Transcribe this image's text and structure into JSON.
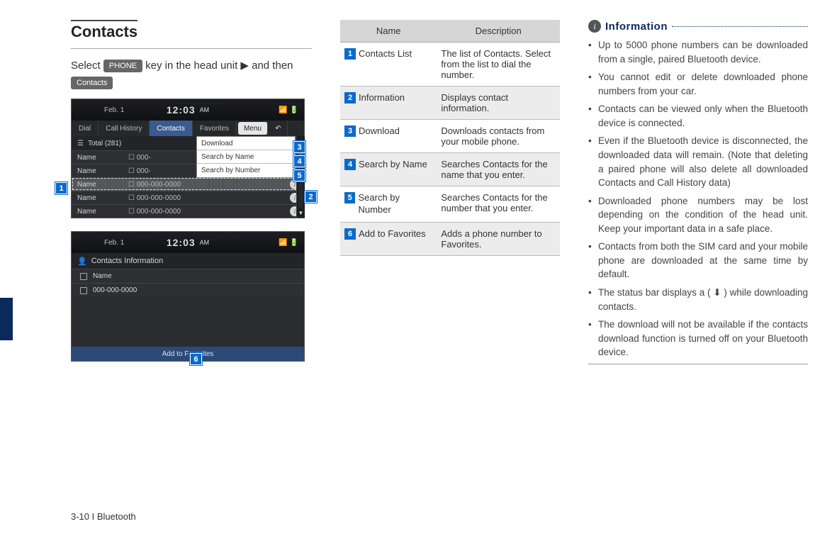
{
  "section_title": "Contacts",
  "intro": {
    "prefix": "Select ",
    "phone_key": "PHONE",
    "mid": " key in the head unit ▶ and then ",
    "contacts_key": "Contacts"
  },
  "screenshot1": {
    "date": "Feb. 1",
    "time": "12:03",
    "ampm": "AM",
    "tabs": {
      "dial": "Dial",
      "history": "Call History",
      "contacts": "Contacts",
      "favorites": "Favorites",
      "menu": "Menu",
      "back": "↶"
    },
    "total_label": "Total (281)",
    "dropdown": {
      "download": "Download",
      "by_name": "Search by Name",
      "by_number": "Search by Number"
    },
    "rows": [
      {
        "name": "Name",
        "phone": "000-"
      },
      {
        "name": "Name",
        "phone": "000-"
      },
      {
        "name": "Name",
        "phone": "000-000-0000",
        "selected": true
      },
      {
        "name": "Name",
        "phone": "000-000-0000"
      },
      {
        "name": "Name",
        "phone": "000-000-0000"
      }
    ]
  },
  "screenshot2": {
    "date": "Feb. 1",
    "time": "12:03",
    "ampm": "AM",
    "title": "Contacts Information",
    "name_row": "Name",
    "phone_row": "000-000-0000",
    "add_fav": "Add to Favorites"
  },
  "callouts": {
    "c1": "1",
    "c2": "2",
    "c3": "3",
    "c4": "4",
    "c5": "5",
    "c6": "6"
  },
  "table": {
    "head_name": "Name",
    "head_desc": "Description",
    "rows": [
      {
        "n": "1",
        "name": "Contacts List",
        "desc": "The list of Contacts. Select from the list to dial the number."
      },
      {
        "n": "2",
        "name": "Information",
        "desc": "Displays contact information."
      },
      {
        "n": "3",
        "name": "Download",
        "desc": "Downloads contacts from your mobile phone."
      },
      {
        "n": "4",
        "name": "Search by Name",
        "desc": "Searches Contacts for the name that you enter."
      },
      {
        "n": "5",
        "name": "Search by Number",
        "desc": "Searches Contacts for the number that you enter."
      },
      {
        "n": "6",
        "name": "Add to Favorites",
        "desc": "Adds a phone number to Favorites."
      }
    ]
  },
  "info": {
    "heading": "Information",
    "items": [
      "Up to 5000 phone numbers can be downloaded from a single, paired Bluetooth device.",
      "You cannot edit or delete downloaded phone numbers from your car.",
      "Contacts can be viewed only when the Bluetooth device is connected.",
      "Even if the Bluetooth device is disconnected, the downloaded data will remain. (Note that deleting a paired phone will also delete all downloaded Contacts and Call History data)",
      "Downloaded phone numbers may be lost depending on the condition of the head unit. Keep your important data in a safe place.",
      "Contacts from both the SIM card and your mobile phone are downloaded at the same time by default.",
      "The status bar displays a ( ⬇ ) while downloading contacts.",
      "The download will not be available if the contacts download function is turned off on your Bluetooth device."
    ]
  },
  "footer": "3-10 I Bluetooth"
}
